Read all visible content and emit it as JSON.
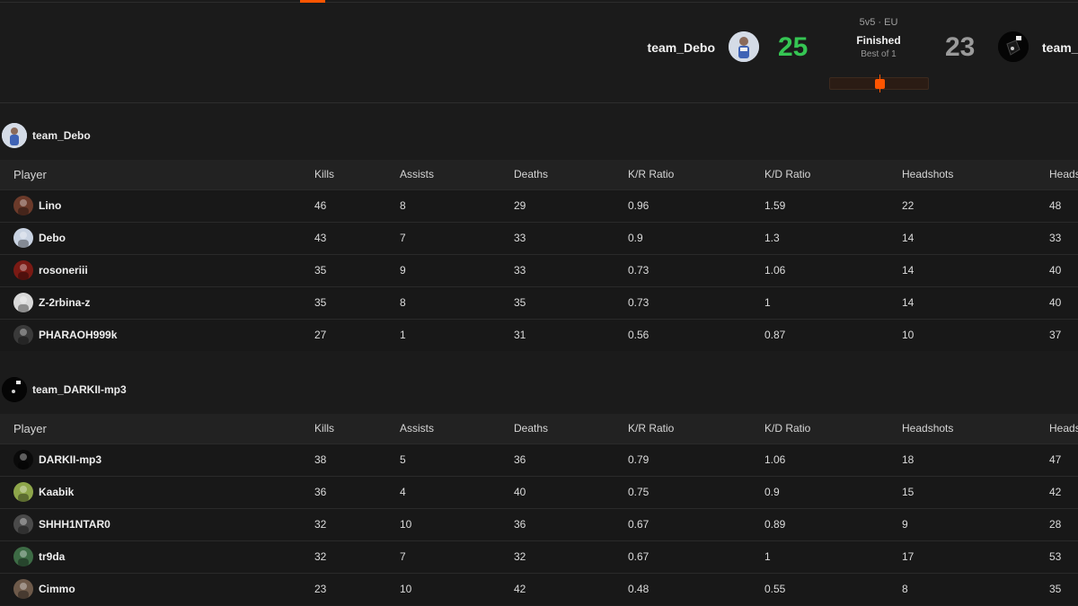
{
  "match": {
    "format": "5v5 · EU",
    "status": "Finished",
    "best_of": "Best of 1",
    "progress_fraction": 0.5,
    "team_left": {
      "name": "team_Debo",
      "score": "25",
      "score_color": "#35c553"
    },
    "team_right": {
      "name": "team_",
      "score": "23",
      "score_color": "#9a9a9a"
    }
  },
  "columns": [
    "Player",
    "Kills",
    "Assists",
    "Deaths",
    "K/R Ratio",
    "K/D Ratio",
    "Headshots",
    "Heads"
  ],
  "teams": [
    {
      "name": "team_Debo",
      "players": [
        {
          "name": "Lino",
          "kills": "46",
          "assists": "8",
          "deaths": "29",
          "kr": "0.96",
          "kd": "1.59",
          "hs": "22",
          "hsp": "48",
          "avatar_color": "#6b3a2a"
        },
        {
          "name": "Debo",
          "kills": "43",
          "assists": "7",
          "deaths": "33",
          "kr": "0.9",
          "kd": "1.3",
          "hs": "14",
          "hsp": "33",
          "avatar_color": "#c9d3e2"
        },
        {
          "name": "rosoneriii",
          "kills": "35",
          "assists": "9",
          "deaths": "33",
          "kr": "0.73",
          "kd": "1.06",
          "hs": "14",
          "hsp": "40",
          "avatar_color": "#7a1a14"
        },
        {
          "name": "Z-2rbina-z",
          "kills": "35",
          "assists": "8",
          "deaths": "35",
          "kr": "0.73",
          "kd": "1",
          "hs": "14",
          "hsp": "40",
          "avatar_color": "#d9d9d9"
        },
        {
          "name": "PHARAOH999k",
          "kills": "27",
          "assists": "1",
          "deaths": "31",
          "kr": "0.56",
          "kd": "0.87",
          "hs": "10",
          "hsp": "37",
          "avatar_color": "#3a3a3a"
        }
      ]
    },
    {
      "name": "team_DARKII-mp3",
      "players": [
        {
          "name": "DARKII-mp3",
          "kills": "38",
          "assists": "5",
          "deaths": "36",
          "kr": "0.79",
          "kd": "1.06",
          "hs": "18",
          "hsp": "47",
          "avatar_color": "#0a0a0a"
        },
        {
          "name": "Kaabik",
          "kills": "36",
          "assists": "4",
          "deaths": "40",
          "kr": "0.75",
          "kd": "0.9",
          "hs": "15",
          "hsp": "42",
          "avatar_color": "#8ea64a"
        },
        {
          "name": "SHHH1NTAR0",
          "kills": "32",
          "assists": "10",
          "deaths": "36",
          "kr": "0.67",
          "kd": "0.89",
          "hs": "9",
          "hsp": "28",
          "avatar_color": "#4a4a4a"
        },
        {
          "name": "tr9da",
          "kills": "32",
          "assists": "7",
          "deaths": "32",
          "kr": "0.67",
          "kd": "1",
          "hs": "17",
          "hsp": "53",
          "avatar_color": "#3d6b45"
        },
        {
          "name": "Cimmo",
          "kills": "23",
          "assists": "10",
          "deaths": "42",
          "kr": "0.48",
          "kd": "0.55",
          "hs": "8",
          "hsp": "35",
          "avatar_color": "#6e5a4a"
        }
      ]
    }
  ]
}
